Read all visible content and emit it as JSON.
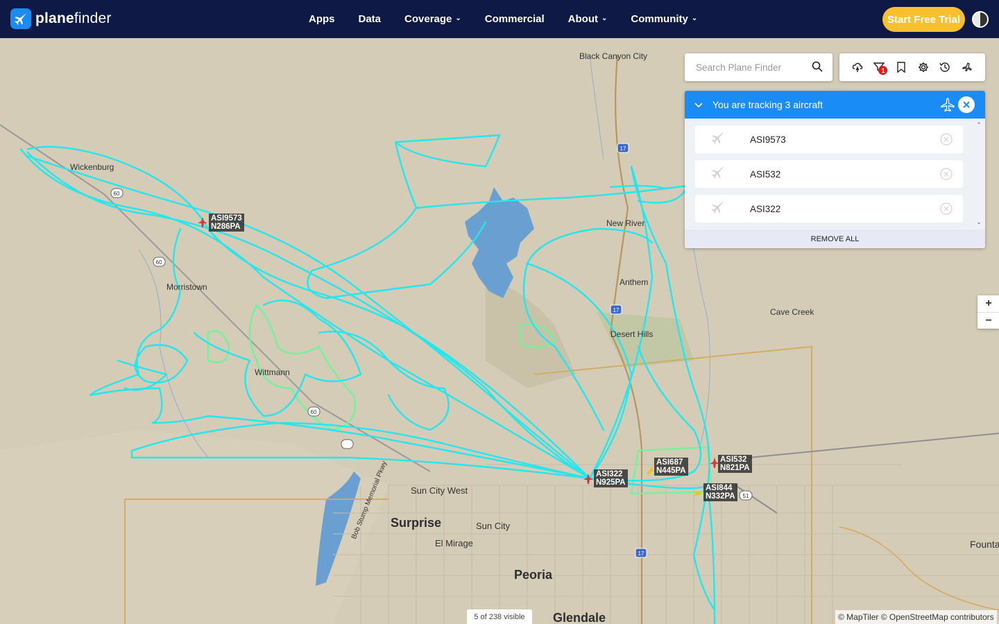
{
  "brand": {
    "name_bold": "plane",
    "name_light": "finder"
  },
  "nav": {
    "items": [
      {
        "label": "Apps",
        "dropdown": false
      },
      {
        "label": "Data",
        "dropdown": false
      },
      {
        "label": "Coverage",
        "dropdown": true
      },
      {
        "label": "Commercial",
        "dropdown": false
      },
      {
        "label": "About",
        "dropdown": true
      },
      {
        "label": "Community",
        "dropdown": true
      }
    ],
    "cta": "Start Free Trial"
  },
  "search": {
    "placeholder": "Search Plane Finder"
  },
  "toolbar": {
    "filter_badge": "1",
    "tools": [
      "weather-icon",
      "filter-icon",
      "bookmark-icon",
      "settings-icon",
      "history-icon",
      "airport-icon"
    ]
  },
  "tracking": {
    "title": "You are tracking 3 aircraft",
    "aircraft": [
      "ASI9573",
      "ASI532",
      "ASI322"
    ],
    "remove_all": "REMOVE ALL"
  },
  "zoom": {
    "in": "+",
    "out": "−"
  },
  "status": {
    "visible": "5 of 238 visible"
  },
  "attribution": "© MapTiler © OpenStreetMap contributors",
  "map_labels": {
    "black_canyon": "Black Canyon City",
    "wickenburg": "Wickenburg",
    "new_river": "New River",
    "morristown": "Morristown",
    "anthem": "Anthem",
    "cave_creek": "Cave Creek",
    "desert_hills": "Desert Hills",
    "wittmann": "Wittmann",
    "sun_city_west": "Sun City West",
    "surprise": "Surprise",
    "sun_city": "Sun City",
    "el_mirage": "El Mirage",
    "peoria": "Peoria",
    "glendale": "Glendale",
    "fountain": "Founta",
    "bob_stump": "Bob Stump Memorial Pkwy",
    "shield_17a": "17",
    "shield_17b": "17",
    "shield_17c": "17",
    "shield_60a": "60",
    "shield_60b": "60",
    "shield_60c": "60",
    "shield_51": "51"
  },
  "aircraft_tags": [
    {
      "callsign": "ASI9573",
      "reg": "N286PA",
      "color": "#d63a3a"
    },
    {
      "callsign": "ASI322",
      "reg": "N925PA",
      "color": "#d63a3a"
    },
    {
      "callsign": "ASI687",
      "reg": "N445PA",
      "color": "#f2c21b"
    },
    {
      "callsign": "ASI532",
      "reg": "N821PA",
      "color": "#d63a3a"
    },
    {
      "callsign": "ASI844",
      "reg": "N332PA",
      "color": "#f2c21b"
    }
  ],
  "colors": {
    "nav_bg": "#0e1a45",
    "accent": "#1a8cf5",
    "cta": "#f6c12c",
    "track_cyan": "#22e7ee",
    "track_green": "#6ef59a",
    "lake": "#6a9fd1",
    "land": "#d4ccb7"
  }
}
